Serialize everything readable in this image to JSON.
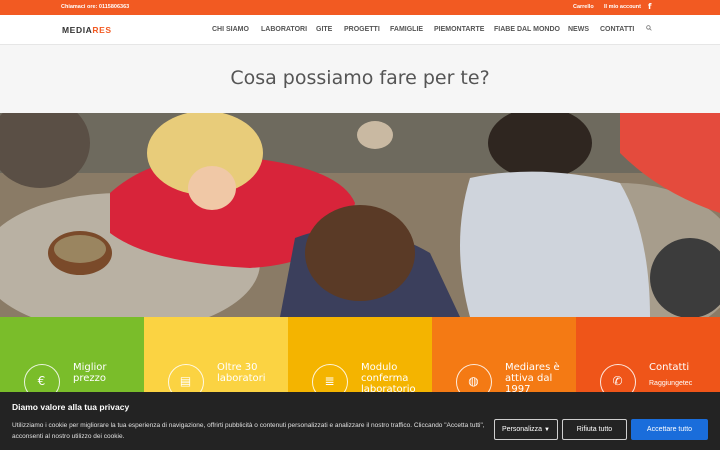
{
  "topbar": {
    "phone": "Chiamaci ore: 0115806363",
    "cart": "Carrello",
    "account": "Il mio account",
    "facebook_icon": "facebook-icon"
  },
  "header": {
    "logo_part1": "MEDIA",
    "logo_part2": "RES",
    "nav": [
      "CHI SIAMO",
      "LABORATORI",
      "GITE",
      "PROGETTI",
      "FAMIGLIE",
      "PIEMONTARTE",
      "FIABE DAL MONDO",
      "NEWS",
      "CONTATTI"
    ],
    "search_icon": "search-icon"
  },
  "hero": {
    "title": "Cosa possiamo fare per te?"
  },
  "tiles": [
    {
      "title": "Miglior prezzo",
      "icon": "euro-icon",
      "color": "#7abd2a"
    },
    {
      "title": "Oltre 30 laboratori",
      "icon": "school-icon",
      "color": "#fbd342"
    },
    {
      "title": "Modulo conferma laboratorio",
      "icon": "document-icon",
      "color": "#f4b400"
    },
    {
      "title": "Mediares è attiva dal 1997",
      "icon": "globe-icon",
      "color": "#f47a14"
    },
    {
      "title": "Contatti",
      "subtitle": "Raggiungetec",
      "icon": "phone-icon",
      "color": "#ef5519"
    }
  ],
  "cookie": {
    "title": "Diamo valore alla tua privacy",
    "body": "Utilizziamo i cookie per migliorare la tua esperienza di navigazione, offrirti pubblicità o contenuti personalizzati e analizzare il nostro traffico. Cliccando \"Accetta tutti\", acconsenti al nostro utilizzo dei cookie.",
    "customize": "Personalizza",
    "reject": "Rifiuta tutto",
    "accept": "Accettare tutto"
  }
}
